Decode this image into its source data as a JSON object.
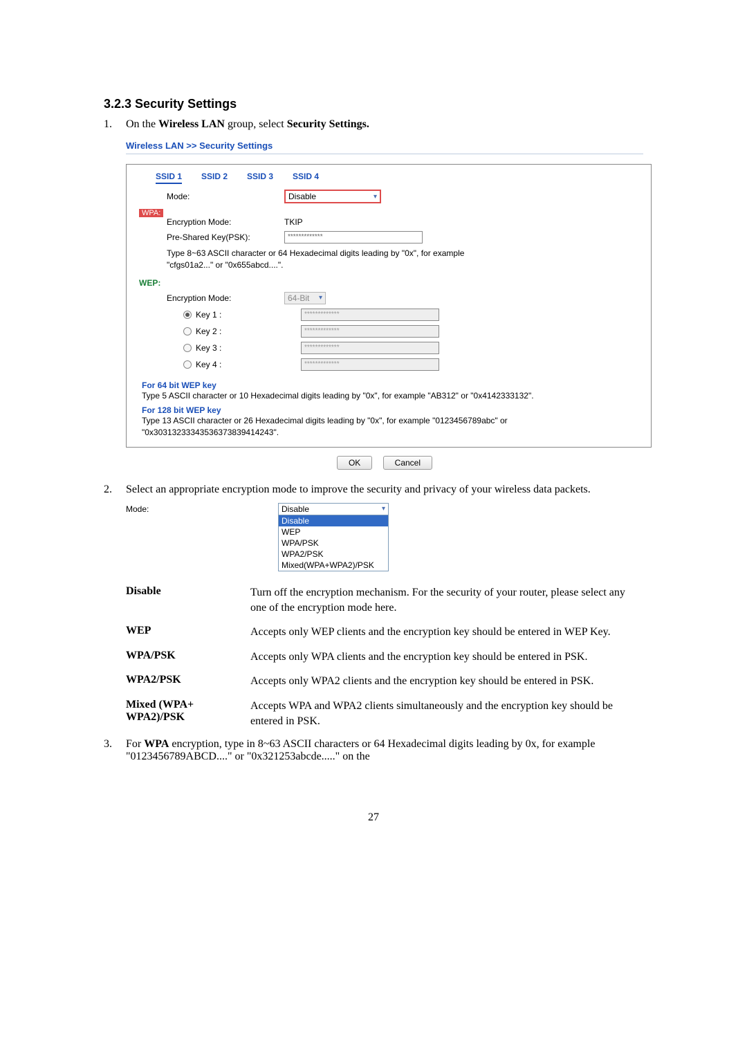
{
  "heading": "3.2.3 Security Settings",
  "step1": {
    "num": "1.",
    "pre": "On the ",
    "bold1": "Wireless LAN",
    "mid": " group, select ",
    "bold2": "Security Settings."
  },
  "panel": {
    "title": "Wireless LAN >> Security Settings",
    "tabs": {
      "t1": "SSID 1",
      "t2": "SSID 2",
      "t3": "SSID 3",
      "t4": "SSID 4"
    },
    "mode_label": "Mode:",
    "mode_value": "Disable",
    "wpa_label": "WPA:",
    "enc_mode_label": "Encryption Mode:",
    "enc_mode_value": "TKIP",
    "psk_label": "Pre-Shared Key(PSK):",
    "psk_value": "*************",
    "psk_help1": "Type 8~63 ASCII character or 64 Hexadecimal digits leading by \"0x\", for example",
    "psk_help2": "\"cfgs01a2...\" or \"0x655abcd....\".",
    "wep_label": "WEP:",
    "wep_mode_label": "Encryption Mode:",
    "wep_mode_value": "64-Bit",
    "key1": "Key 1 :",
    "key2": "Key 2 :",
    "key3": "Key 3 :",
    "key4": "Key 4 :",
    "key_value": "*************",
    "k64_head": "For 64 bit WEP key",
    "k64_body": "Type 5 ASCII character or 10 Hexadecimal digits leading by \"0x\", for example \"AB312\" or \"0x4142333132\".",
    "k128_head": "For 128 bit WEP key",
    "k128_body": "Type 13 ASCII character or 26 Hexadecimal digits leading by \"0x\", for example \"0123456789abc\" or \"0x30313233343536373839414243\".",
    "ok": "OK",
    "cancel": "Cancel"
  },
  "step2": {
    "num": "2.",
    "text": "Select an appropriate encryption mode to improve the security and privacy of your wireless data packets.",
    "mode_label": "Mode:",
    "selected": "Disable",
    "opts": {
      "o1": "Disable",
      "o2": "WEP",
      "o3": "WPA/PSK",
      "o4": "WPA2/PSK",
      "o5": "Mixed(WPA+WPA2)/PSK"
    }
  },
  "defs": {
    "disable_t": "Disable",
    "disable_d": "Turn off the encryption mechanism. For the security of your router, please select any one of the encryption mode here.",
    "wep_t": "WEP",
    "wep_d": "Accepts only WEP clients and the encryption key should be entered in WEP Key.",
    "wpapsk_t": "WPA/PSK",
    "wpapsk_d": "Accepts only WPA clients and the encryption key should be entered in PSK.",
    "wpa2psk_t": "WPA2/PSK",
    "wpa2psk_d": "Accepts only WPA2 clients and the encryption key should be entered in PSK.",
    "mixed_t": "Mixed (WPA+ WPA2)/PSK",
    "mixed_d": "Accepts WPA and WPA2 clients simultaneously and the encryption key should be entered in PSK."
  },
  "step3": {
    "num": "3.",
    "pre": "For ",
    "bold": "WPA",
    "rest": " encryption, type in 8~63 ASCII characters or 64 Hexadecimal digits leading by 0x, for example \"0123456789ABCD....\" or \"0x321253abcde.....\" on the"
  },
  "pagenum": "27"
}
